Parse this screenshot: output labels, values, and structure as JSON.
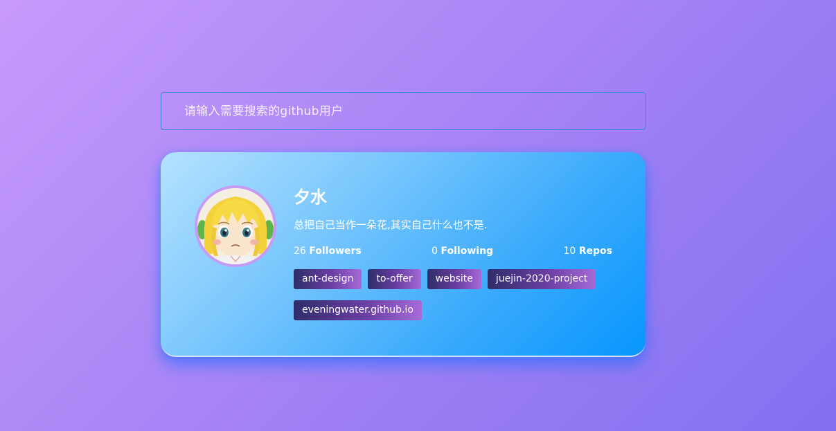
{
  "search": {
    "placeholder": "请输入需要搜索的github用户",
    "value": ""
  },
  "profile": {
    "name": "夕水",
    "bio": "总把自己当作一朵花,其实自己什么也不是.",
    "avatar_icon": "anime-girl-avatar",
    "stats": [
      {
        "count": "26",
        "label": "Followers"
      },
      {
        "count": "0",
        "label": "Following"
      },
      {
        "count": "10",
        "label": "Repos"
      }
    ],
    "repos": [
      "ant-design",
      "to-offer",
      "website",
      "juejin-2020-project",
      "eveningwater.github.io"
    ]
  },
  "colors": {
    "background_start": "#c79afb",
    "background_end": "#8270f0",
    "card_start": "#b5e2ff",
    "card_end": "#0896fe",
    "search_border": "#3b86d8",
    "avatar_border": "#c69bf6",
    "tag_start": "#2e2d68",
    "tag_end": "#a66ad7"
  }
}
